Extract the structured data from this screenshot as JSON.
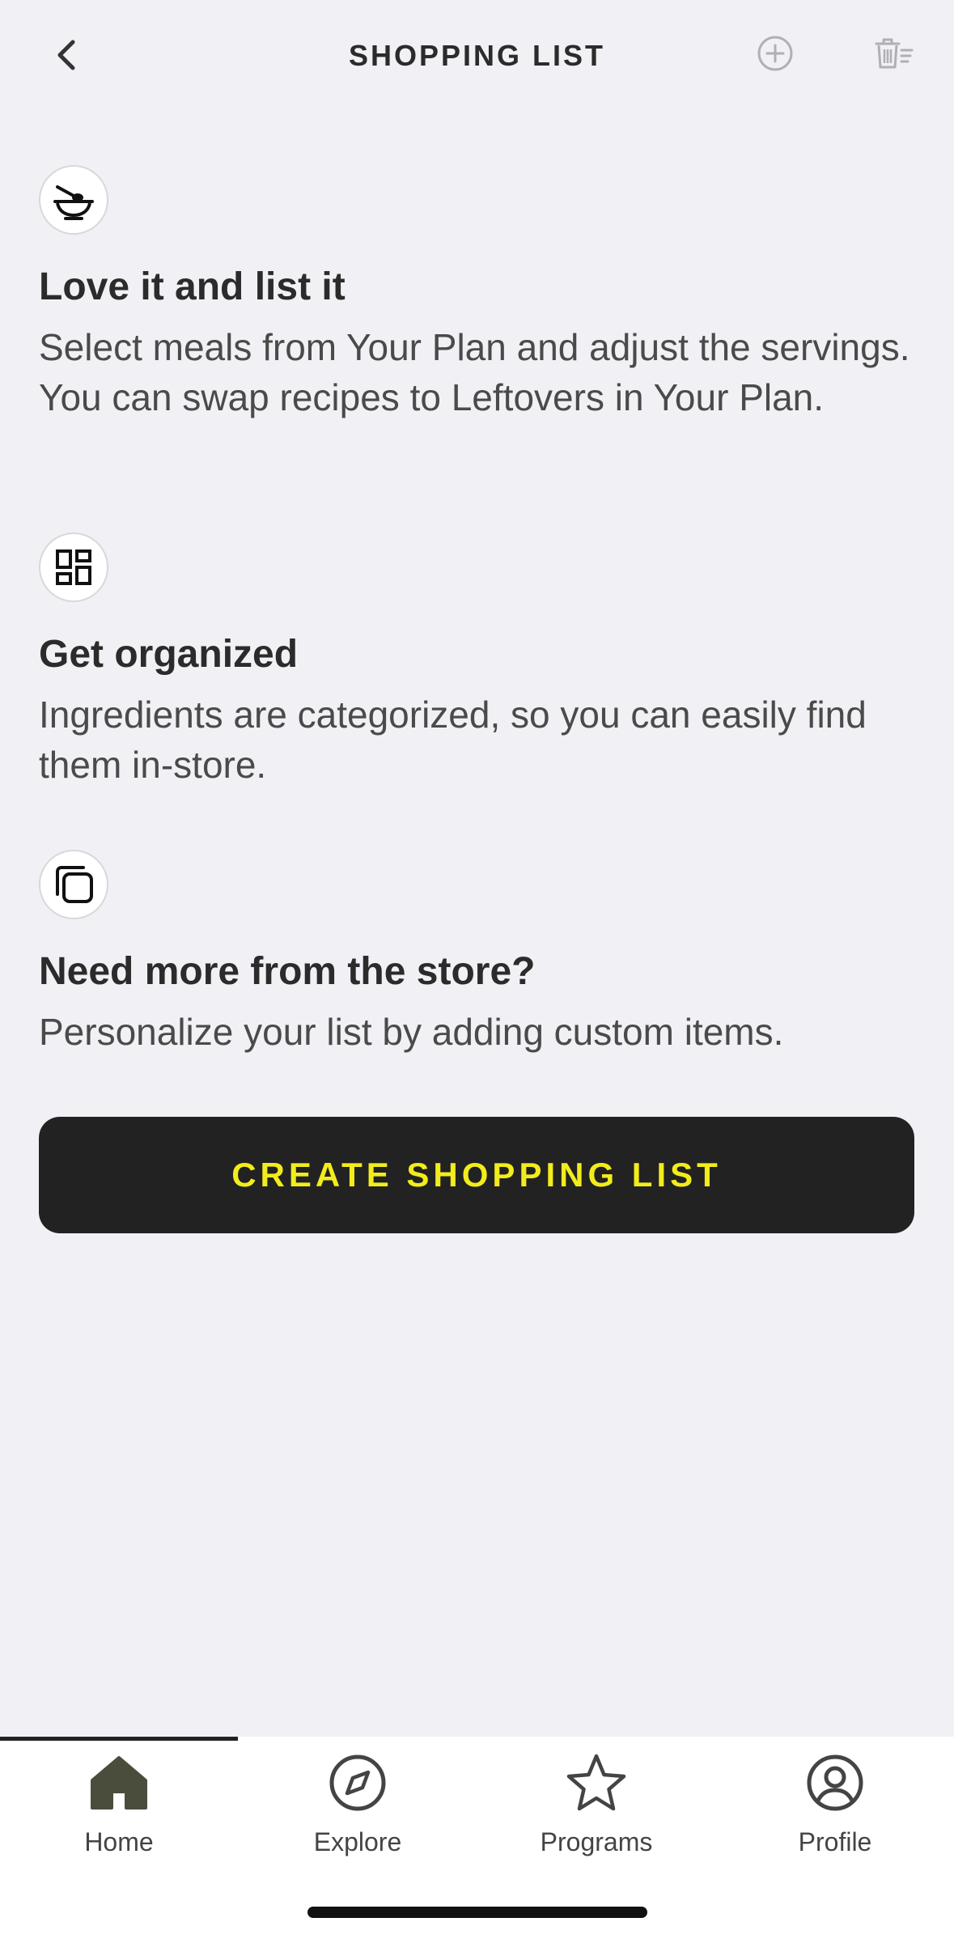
{
  "header": {
    "title": "SHOPPING LIST",
    "back_icon": "chevron-left-icon",
    "add_icon": "plus-circle-icon",
    "trash_icon": "trash-list-icon"
  },
  "features": [
    {
      "icon": "bowl-icon",
      "title": "Love it and list it",
      "description": "Select meals from Your Plan and adjust the servings. You can swap recipes to Leftovers in Your Plan."
    },
    {
      "icon": "dashboard-icon",
      "title": "Get organized",
      "description": "Ingredients are categorized, so you can easily find them in-store."
    },
    {
      "icon": "copy-icon",
      "title": "Need more from the store?",
      "description": "Personalize your list by adding custom items."
    }
  ],
  "cta": {
    "label": "CREATE SHOPPING LIST",
    "bg": "#222222",
    "fg": "#f2ec1c"
  },
  "tabs": [
    {
      "label": "Home",
      "icon": "home-icon",
      "active": true
    },
    {
      "label": "Explore",
      "icon": "compass-icon",
      "active": false
    },
    {
      "label": "Programs",
      "icon": "star-icon",
      "active": false
    },
    {
      "label": "Profile",
      "icon": "profile-icon",
      "active": false
    }
  ]
}
